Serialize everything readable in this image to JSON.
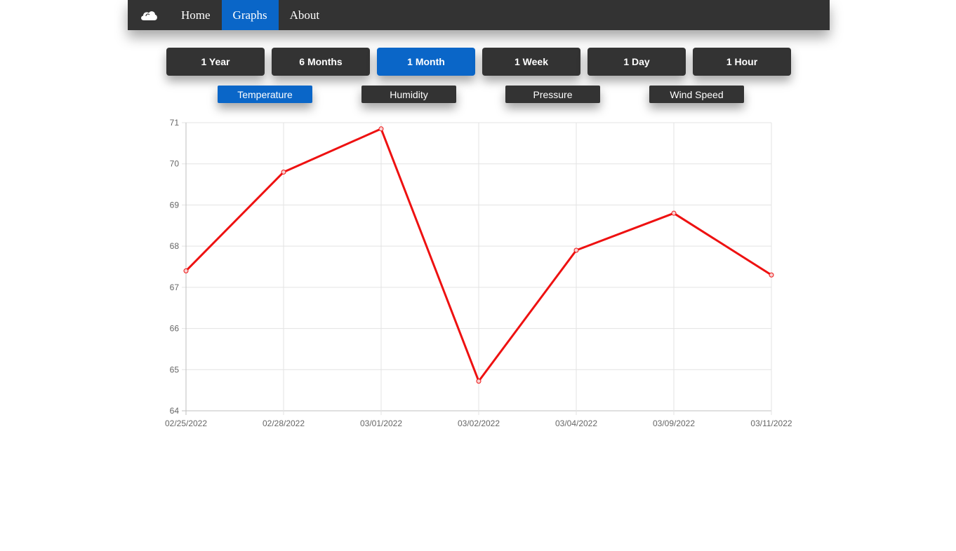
{
  "nav": {
    "logo_icon": "cloud-icon",
    "items": [
      {
        "label": "Home",
        "active": false
      },
      {
        "label": "Graphs",
        "active": true
      },
      {
        "label": "About",
        "active": false
      }
    ]
  },
  "ranges": [
    {
      "label": "1 Year",
      "active": false
    },
    {
      "label": "6 Months",
      "active": false
    },
    {
      "label": "1 Month",
      "active": true
    },
    {
      "label": "1 Week",
      "active": false
    },
    {
      "label": "1 Day",
      "active": false
    },
    {
      "label": "1 Hour",
      "active": false
    }
  ],
  "metrics": [
    {
      "label": "Temperature",
      "active": true
    },
    {
      "label": "Humidity",
      "active": false
    },
    {
      "label": "Pressure",
      "active": false
    },
    {
      "label": "Wind Speed",
      "active": false
    }
  ],
  "colors": {
    "accent": "#0a66c8",
    "button": "#333333",
    "line": "#ee1111"
  },
  "chart_data": {
    "type": "line",
    "x": [
      "02/25/2022",
      "02/28/2022",
      "03/01/2022",
      "03/02/2022",
      "03/04/2022",
      "03/09/2022",
      "03/11/2022"
    ],
    "series": [
      {
        "values": [
          67.4,
          69.8,
          70.85,
          64.72,
          67.9,
          68.8,
          67.3
        ]
      }
    ],
    "ylim": [
      64,
      71
    ],
    "yticks": [
      64,
      65,
      66,
      67,
      68,
      69,
      70,
      71
    ],
    "grid": true,
    "legend": false
  }
}
